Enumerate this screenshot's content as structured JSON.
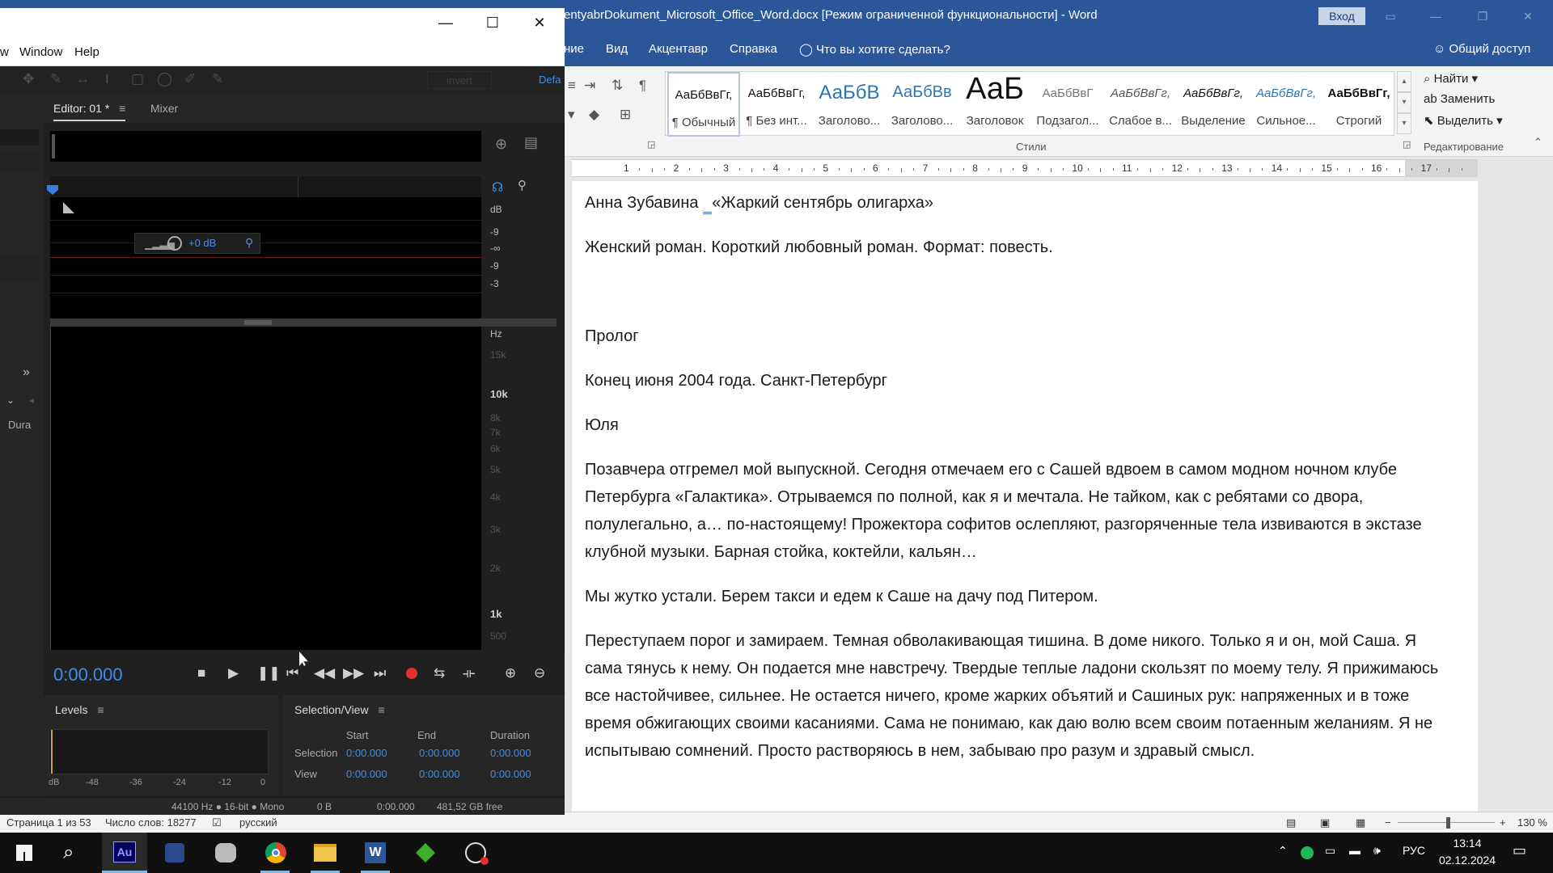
{
  "word": {
    "title": "entyabrDokument_Microsoft_Office_Word.docx [Режим ограниченной функциональности]  -  Word",
    "login_label": "Вход",
    "tabs": [
      "ние",
      "Вид",
      "Акцентавр",
      "Справка"
    ],
    "tell_me": "Что вы хотите сделать?",
    "share": "Общий доступ",
    "styles": [
      {
        "sample": "АаБбВвГг,",
        "label": "¶ Обычный"
      },
      {
        "sample": "АаБбВвГг,",
        "label": "¶ Без инт..."
      },
      {
        "sample": "АаБбВ",
        "label": "Заголово..."
      },
      {
        "sample": "АаБбВв",
        "label": "Заголово..."
      },
      {
        "sample": "АаБ",
        "label": "Заголовок"
      },
      {
        "sample": "АаБбВвГ",
        "label": "Подзагол..."
      },
      {
        "sample": "АаБбВвГг,",
        "label": "Слабое в..."
      },
      {
        "sample": "АаБбВвГг,",
        "label": "Выделение"
      },
      {
        "sample": "АаБбВвГг,",
        "label": "Сильное..."
      },
      {
        "sample": "АаБбВвГг,",
        "label": "Строгий"
      }
    ],
    "styles_group_label": "Стили",
    "editing": {
      "find": "Найти",
      "replace": "Заменить",
      "select": "Выделить",
      "group_label": "Редактирование"
    },
    "ruler_numbers": [
      "1",
      "2",
      "3",
      "4",
      "5",
      "6",
      "7",
      "8",
      "9",
      "10",
      "11",
      "12",
      "13",
      "14",
      "15",
      "16",
      "17"
    ],
    "document": {
      "heading_author": "Анна Зубавина ",
      "heading_gap": "  ",
      "heading_title": "«Жаркий сентябрь олигарха»",
      "p1": "Женский роман. Короткий любовный роман.  Формат: повесть.",
      "p2": "Пролог",
      "p3": "Конец июня 2004 года. Санкт-Петербург",
      "p4": "Юля",
      "p5": "Позавчера отгремел мой выпускной. Сегодня отмечаем его с Сашей вдвоем в самом модном ночном клубе Петербурга «Галактика». Отрываемся по полной, как я и мечтала. Не тайком, как с ребятами со двора, полулегально, а… по-настоящему! Прожектора софитов ослепляют, разгоряченные тела извиваются в экстазе клубной музыки. Барная стойка, коктейли, кальян…",
      "p6": "Мы жутко устали. Берем такси и едем к Саше на дачу под Питером.",
      "p7": "Переступаем порог и замираем. Темная обволакивающая тишина. В доме никого. Только я и он, мой Саша. Я сама тянусь к нему. Он подается мне навстречу. Твердые теплые ладони скользят по моему телу. Я прижимаюсь все настойчивее, сильнее. Не остается ничего, кроме жарких объятий и Сашиных рук: напряженных и в тоже время обжигающих своими касаниями. Сама не понимаю, как даю волю всем своим потаенным желаниям. Я не испытываю сомнений. Просто растворяюсь в нем, забываю про разум и здравый смысл."
    },
    "status": {
      "page": "Страница 1 из 53",
      "words": "Число слов: 18277",
      "language": "русский",
      "zoom": "130 %"
    }
  },
  "audition": {
    "menu": [
      "w",
      "Window",
      "Help"
    ],
    "toolbar_default": "Defa",
    "toolbar_invert": "invert",
    "editor_tab": "Editor: 01 *",
    "mixer_tab": "Mixer",
    "left_labels": {
      "dura": "Dura"
    },
    "hud_gain": "+0 dB",
    "db_ruler": [
      "dB",
      "-9",
      "-∞",
      "-9",
      "-3"
    ],
    "hz_ruler": {
      "unit": "Hz",
      "labels": [
        "15k",
        "10k",
        "8k",
        "7k",
        "6k",
        "5k",
        "4k",
        "3k",
        "2k",
        "1k",
        "500"
      ]
    },
    "time": "0:00.000",
    "levels": {
      "title": "Levels",
      "scale": [
        "dB",
        "-48",
        "-36",
        "-24",
        "-12",
        "0"
      ]
    },
    "selection_view": {
      "title": "Selection/View",
      "headers": [
        "Start",
        "End",
        "Duration"
      ],
      "rows": [
        {
          "label": "Selection",
          "start": "0:00.000",
          "end": "0:00.000",
          "duration": "0:00.000"
        },
        {
          "label": "View",
          "start": "0:00.000",
          "end": "0:00.000",
          "duration": "0:00.000"
        }
      ]
    },
    "status": {
      "format": "44100 Hz ● 16-bit ● Mono",
      "size": "0 B",
      "duration": "0:00.000",
      "free": "481,52 GB free"
    }
  },
  "taskbar": {
    "tray_lang": "РУС",
    "time": "13:14",
    "date": "02.12.2024"
  },
  "colors": {
    "word_accent": "#2b579a",
    "audition_blue": "#3b8eea",
    "record_red": "#e0312e"
  }
}
